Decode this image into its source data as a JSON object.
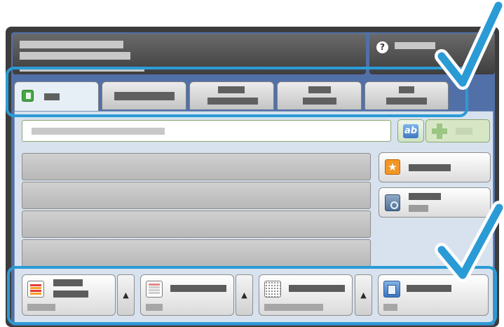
{
  "screen": {
    "icons": {
      "help": "help-icon",
      "fax_tab": "fax-icon",
      "keyboard": "keyboard-icon",
      "add": "plus-icon",
      "favorites": "star-icon",
      "address_book": "address-book-icon",
      "feature_1": "color-document-icon",
      "feature_2": "document-icon",
      "feature_3": "halftone-document-icon",
      "feature_4": "copy-document-icon",
      "scroll": "triangle-up-icon"
    },
    "help_glyph": "?",
    "keyboard_glyph": "ab",
    "favorites_glyph": "★",
    "arrow_glyph": "▲",
    "colors": {
      "accent_outline": "#2b9bd6",
      "screen_background": "#5270a8",
      "content_background": "#d7e2ee"
    }
  }
}
